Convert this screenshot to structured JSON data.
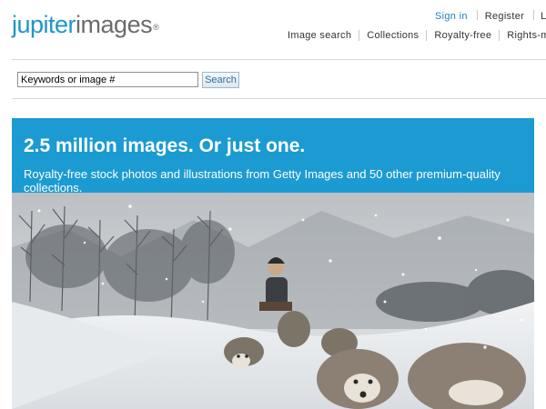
{
  "header": {
    "logo": {
      "part1": "jupiter",
      "part2": "images",
      "mark": "®"
    },
    "sign_in": "Sign in",
    "register": "Register",
    "truncated_link": "Li",
    "nav": [
      "Image search",
      "Collections",
      "Royalty-free",
      "Rights-m"
    ]
  },
  "search": {
    "value": "Keywords or image #",
    "button": "Search"
  },
  "hero": {
    "headline": "2.5 million images. Or just one.",
    "subhead": "Royalty-free stock photos and illustrations from Getty Images and 50 other premium-quality collections."
  },
  "colors": {
    "brand_blue": "#1f96c9",
    "banner_blue": "#1b9bd2",
    "logo_gray": "#6b6b6b"
  }
}
